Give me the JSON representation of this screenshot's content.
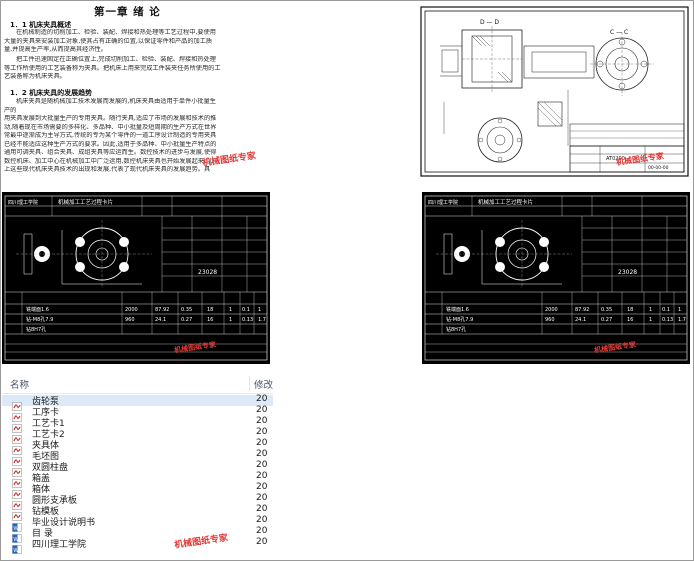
{
  "document": {
    "title": "第一章   绪  论",
    "section1": "1．1 机床夹具概述",
    "para1": [
      "在机械制造的切削加工、检验、装配、焊接和热处理等工艺过程中,要使用",
      "大量的夹具来安装加工对象,使其占有正确的位置,以保证零件和产品的加工质",
      "量,并提高生产率,从而提高其经济性。"
    ],
    "para2": [
      "把工件迅速固定在正确位置上,完成切削加工、检验、装配、焊接和热处理",
      "等工作所使用的工艺装备称为夹具。把机床上用来完成工件装夹任务所使用的工",
      "艺装备称为机床夹具。"
    ],
    "section2": "1．2 机床夹具的发展趋势",
    "para3": [
      "机床夹具是随机械加工技术发展而发展的,机床夹具由适用于单件小批量生",
      "产的",
      "用夹具发展到大批量生产的专用夹具。随行夹具,适应了市场的发展和技术的推",
      "动,随着现在市场需要的多样化、多品种、中小批量及短周期的生产方式在世界",
      "常最中逐渐成为主导方式,传统的专为某个零件的一道工序设计制造的专用夹具",
      "已经不能适应这种生产方式的要求。因此,适用于多品种、中小批量生产特点的",
      "通用可调夹具、组合夹具、成组夹具等应运而生。数控技术的进步与发展,使得",
      "数控机床、加工中心在机械加工中广泛运用,数控机床夹具也开始发展起来,以",
      "上这些现代机床夹具技术的出现和发展,代表了现代机床夹具的发展趋势。具"
    ]
  },
  "drawing": {
    "section_dd": "D — D",
    "section_cc": "C — C",
    "title_code": "AT0200",
    "sheet_code": "00-00-00"
  },
  "process_cards": [
    {
      "header": "四川理工学院",
      "card_title": "机械加工工艺过程卡片",
      "part_no": "23028",
      "rows": [
        {
          "name": "铣端面1.6",
          "v1": "2000",
          "v2": "87.92",
          "v3": "0.35",
          "v4": "18",
          "v5": "1",
          "v6": "0.1",
          "v7": "1"
        },
        {
          "name": "钻-M8孔7.9",
          "v1": "960",
          "v2": "24.1",
          "v3": "0.27",
          "v4": "16",
          "v5": "1",
          "v6": "0.13",
          "v7": "1.7"
        },
        {
          "name": "钻8H7孔",
          "v1": "",
          "v2": "",
          "v3": "",
          "v4": "",
          "v5": "",
          "v6": "",
          "v7": ""
        }
      ]
    },
    {
      "header": "四川理工学院",
      "card_title": "机械加工工艺过程卡片",
      "part_no": "23028",
      "rows": [
        {
          "name": "铣端面1.6",
          "v1": "2000",
          "v2": "87.92",
          "v3": "0.35",
          "v4": "18",
          "v5": "1",
          "v6": "0.1",
          "v7": "1"
        },
        {
          "name": "钻-M8孔7.9",
          "v1": "960",
          "v2": "24.1",
          "v3": "0.27",
          "v4": "16",
          "v5": "1",
          "v6": "0.13",
          "v7": "1.7"
        },
        {
          "name": "钻8H7孔",
          "v1": "",
          "v2": "",
          "v3": "",
          "v4": "",
          "v5": "",
          "v6": "",
          "v7": ""
        }
      ]
    }
  ],
  "explorer": {
    "col_name": "名称",
    "col_date": "修改",
    "items": [
      {
        "name": "齿轮泵",
        "date": "20",
        "icon": "pdf-icon",
        "selected": true
      },
      {
        "name": "工序卡",
        "date": "20",
        "icon": "pdf-icon"
      },
      {
        "name": "工艺卡1",
        "date": "20",
        "icon": "pdf-icon"
      },
      {
        "name": "工艺卡2",
        "date": "20",
        "icon": "pdf-icon"
      },
      {
        "name": "夹具体",
        "date": "20",
        "icon": "pdf-icon"
      },
      {
        "name": "毛坯图",
        "date": "20",
        "icon": "pdf-icon"
      },
      {
        "name": "双圆柱盘",
        "date": "20",
        "icon": "pdf-icon"
      },
      {
        "name": "箱盖",
        "date": "20",
        "icon": "pdf-icon"
      },
      {
        "name": "箱体",
        "date": "20",
        "icon": "pdf-icon"
      },
      {
        "name": "圆形支承板",
        "date": "20",
        "icon": "pdf-icon"
      },
      {
        "name": "钻模板",
        "date": "20",
        "icon": "pdf-icon"
      },
      {
        "name": "毕业设计说明书",
        "date": "20",
        "icon": "word-icon"
      },
      {
        "name": "目 录",
        "date": "20",
        "icon": "word-icon"
      },
      {
        "name": "四川理工学院",
        "date": "20",
        "icon": "word-icon"
      }
    ]
  },
  "watermark": "机械图纸专家",
  "colors": {
    "selection": "#dbe9f8",
    "watermark": "#e03a3a",
    "pdf_icon": "#c62828",
    "word_icon": "#2b63b8"
  }
}
